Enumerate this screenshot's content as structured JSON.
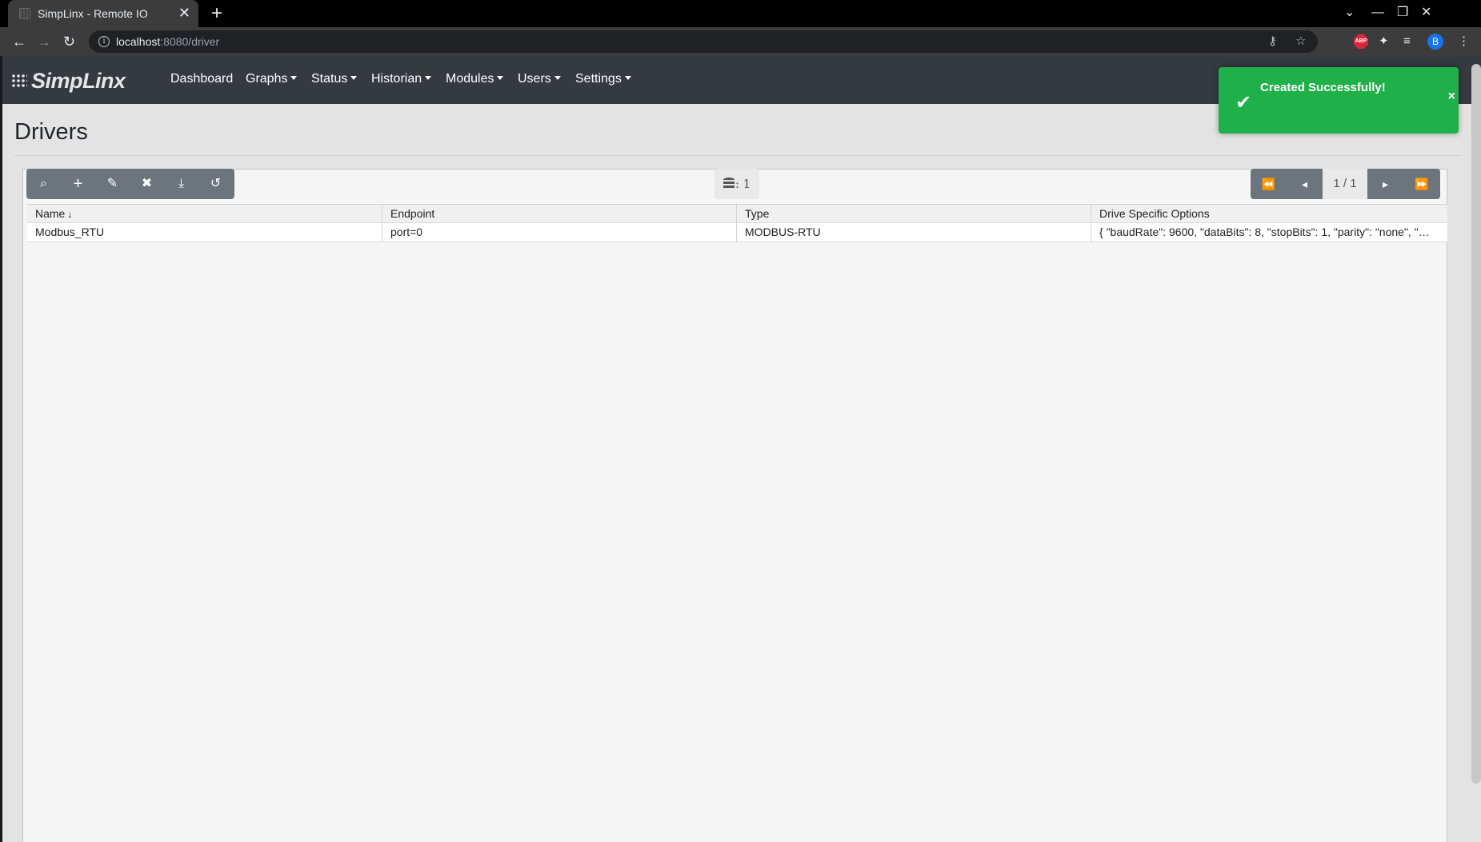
{
  "browser": {
    "tab_title": "SimpLinx - Remote IO",
    "tab_close": "✕",
    "new_tab": "+",
    "url_host": "localhost",
    "url_path": ":8080/driver",
    "profile_initial": "B",
    "abp_label": "ABP"
  },
  "navbar": {
    "brand": "SimpLinx",
    "items": [
      {
        "label": "Dashboard"
      },
      {
        "label": "Graphs"
      },
      {
        "label": "Status"
      },
      {
        "label": "Historian"
      },
      {
        "label": "Modules"
      },
      {
        "label": "Users"
      },
      {
        "label": "Settings"
      }
    ]
  },
  "page": {
    "title": "Drivers"
  },
  "grid": {
    "record_count": ": 1",
    "pager": "1 / 1",
    "columns": [
      "Name",
      "Endpoint",
      "Type",
      "Drive Specific Options"
    ],
    "sort_indicator": "↓",
    "rows": [
      {
        "name": "Modbus_RTU",
        "endpoint": "port=0",
        "type": "MODBUS-RTU",
        "options": "{ \"baudRate\": 9600, \"dataBits\": 8, \"stopBits\": 1, \"parity\": \"none\", \"…"
      }
    ]
  },
  "toast": {
    "message": "Created Successfully!",
    "close": "×",
    "color": "#20b04a"
  },
  "colors": {
    "navbar": "#343a40",
    "button_group": "#6c757d"
  }
}
